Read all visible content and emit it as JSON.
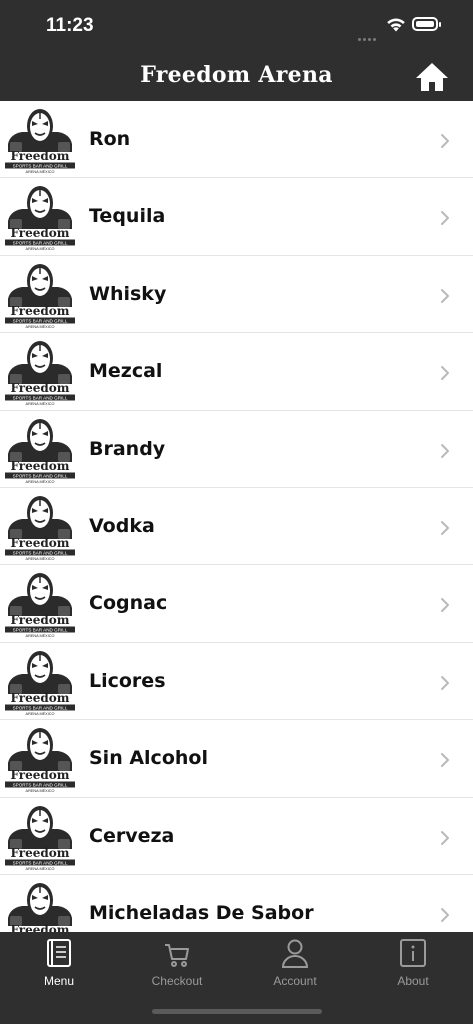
{
  "status_bar": {
    "time": "11:23"
  },
  "nav": {
    "title": "Freedom Arena",
    "home_icon": "home-icon"
  },
  "logo": {
    "brand": "Freedom",
    "banner": "SPORTS BAR AND GRILL",
    "location": "ARENA MÉXICO"
  },
  "menu_items": [
    {
      "label": "Ron"
    },
    {
      "label": "Tequila"
    },
    {
      "label": "Whisky"
    },
    {
      "label": "Mezcal"
    },
    {
      "label": "Brandy"
    },
    {
      "label": "Vodka"
    },
    {
      "label": "Cognac"
    },
    {
      "label": "Licores"
    },
    {
      "label": "Sin Alcohol"
    },
    {
      "label": "Cerveza"
    },
    {
      "label": "Micheladas De Sabor"
    }
  ],
  "tabs": [
    {
      "label": "Menu",
      "icon": "book-icon",
      "active": true
    },
    {
      "label": "Checkout",
      "icon": "cart-icon",
      "active": false
    },
    {
      "label": "Account",
      "icon": "person-icon",
      "active": false
    },
    {
      "label": "About",
      "icon": "info-icon",
      "active": false
    }
  ],
  "colors": {
    "bar_background": "#2f2f2f",
    "active_tab": "#ffffff",
    "inactive_tab": "#9a9a9a"
  }
}
